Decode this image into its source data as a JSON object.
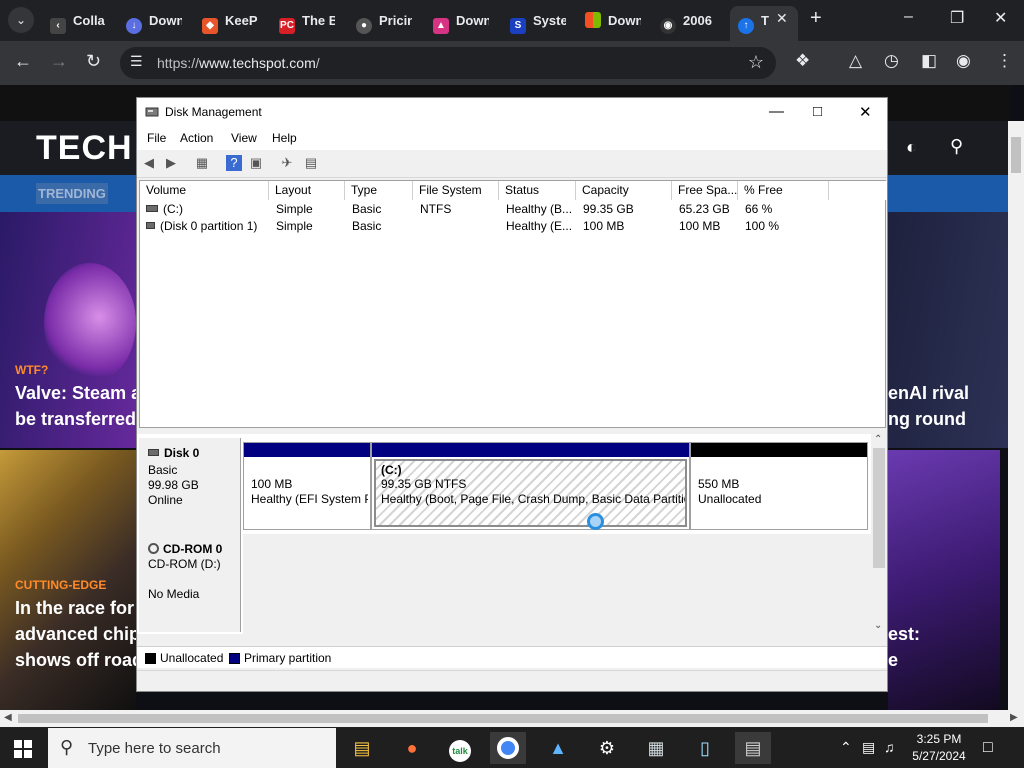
{
  "browser": {
    "tabs": [
      {
        "label": "Colla",
        "icon": "collab-favicon-icon"
      },
      {
        "label": "Down",
        "icon": "download-favicon-icon"
      },
      {
        "label": "KeeP",
        "icon": "keep-favicon-icon"
      },
      {
        "label": "The B",
        "icon": "pc-favicon-icon"
      },
      {
        "label": "Pricin",
        "icon": "pricing-favicon-icon"
      },
      {
        "label": "Down",
        "icon": "download2-favicon-icon"
      },
      {
        "label": "Syste",
        "icon": "system-favicon-icon"
      },
      {
        "label": "Down",
        "icon": "windows-favicon-icon"
      },
      {
        "label": "2006",
        "icon": "github-favicon-icon"
      },
      {
        "label": "T",
        "icon": "techspot-favicon-icon"
      }
    ],
    "url_prefix": "https://",
    "url_host": "www.techspot.com",
    "url_path": "/"
  },
  "site": {
    "logo": "TECH",
    "trending": "TRENDING",
    "cards": [
      {
        "kicker": "WTF?",
        "line1": "Valve: Steam ac",
        "line2": "be transferred a"
      },
      {
        "kicker": "CUTTING-EDGE",
        "line1": "In the race for t",
        "line2": "advanced chips",
        "line3": "shows off road"
      }
    ],
    "right_line1": "enAI rival",
    "right_line2": "ng round",
    "right_line3": "est:",
    "right_line4": "e"
  },
  "dm": {
    "title": "Disk Management",
    "menu": [
      "File",
      "Action",
      "View",
      "Help"
    ],
    "columns": [
      "Volume",
      "Layout",
      "Type",
      "File System",
      "Status",
      "Capacity",
      "Free Spa...",
      "% Free"
    ],
    "rows": [
      [
        "(C:)",
        "Simple",
        "Basic",
        "NTFS",
        "Healthy (B...",
        "99.35 GB",
        "65.23 GB",
        "66 %"
      ],
      [
        "(Disk 0 partition 1)",
        "Simple",
        "Basic",
        "",
        "Healthy (E...",
        "100 MB",
        "100 MB",
        "100 %"
      ]
    ],
    "disk0": {
      "name": "Disk 0",
      "type": "Basic",
      "size": "99.98 GB",
      "state": "Online",
      "partitions": [
        {
          "line1": "",
          "line2": "100 MB",
          "line3": "Healthy (EFI System P"
        },
        {
          "line1": "(C:)",
          "line2": "99.35 GB NTFS",
          "line3": "Healthy (Boot, Page File, Crash Dump, Basic Data Partition"
        },
        {
          "line1": "",
          "line2": "550 MB",
          "line3": "Unallocated"
        }
      ]
    },
    "cdrom": {
      "name": "CD-ROM 0",
      "type": "CD-ROM (D:)",
      "media": "No Media"
    },
    "legend": [
      "Unallocated",
      "Primary partition"
    ],
    "colors": {
      "primary": "#000080",
      "unallocated": "#000000"
    }
  },
  "taskbar": {
    "search_placeholder": "Type here to search",
    "time": "3:25 PM",
    "date": "5/27/2024"
  }
}
